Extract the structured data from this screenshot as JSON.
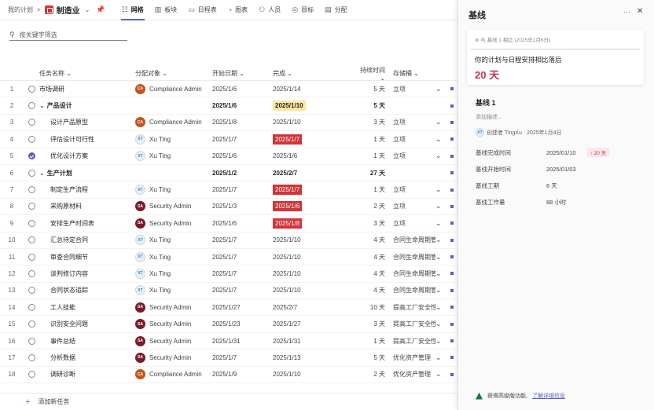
{
  "topbar": {
    "breadcrumb_root": "我的计划",
    "breadcrumb_sep": ">",
    "project_name": "制造业",
    "tabs": [
      {
        "label": "网格",
        "icon": "grid-icon"
      },
      {
        "label": "板块",
        "icon": "board-icon"
      },
      {
        "label": "日程表",
        "icon": "calendar-icon"
      },
      {
        "label": "图表",
        "icon": "chart-icon"
      },
      {
        "label": "人员",
        "icon": "people-icon"
      },
      {
        "label": "目标",
        "icon": "goal-icon"
      },
      {
        "label": "分配",
        "icon": "assign-icon"
      }
    ]
  },
  "filter": {
    "placeholder": "按关键字筛选"
  },
  "columns": {
    "name": "任务名称",
    "assignee": "分配对象",
    "start": "开始日期",
    "end": "完成",
    "duration": "持续时间",
    "bucket": "存储桶"
  },
  "rows": [
    {
      "num": "1",
      "name": "市场调研",
      "level": "top",
      "assignee": "Compliance Admin",
      "av": "ca",
      "av_text": "CA",
      "start": "2025/1/6",
      "end": "2025/1/14",
      "end_style": "",
      "duration": "5 天",
      "bucket": "立项",
      "done": false
    },
    {
      "num": "2",
      "name": "产品设计",
      "level": "group",
      "assignee": "",
      "av": "",
      "av_text": "",
      "start": "2025/1/6",
      "end": "2025/1/10",
      "end_style": "hl",
      "duration": "5 天",
      "bucket": "",
      "done": false
    },
    {
      "num": "3",
      "name": "设计产品原型",
      "level": "sub",
      "assignee": "Compliance Admin",
      "av": "ca",
      "av_text": "CA",
      "start": "2025/1/8",
      "end": "2025/1/10",
      "end_style": "",
      "duration": "3 天",
      "bucket": "立项",
      "done": false
    },
    {
      "num": "4",
      "name": "评估设计可行性",
      "level": "sub",
      "assignee": "Xu Ting",
      "av": "xt",
      "av_text": "XT",
      "start": "2025/1/7",
      "end": "2025/1/7",
      "end_style": "late",
      "duration": "1 天",
      "bucket": "立项",
      "done": false
    },
    {
      "num": "5",
      "name": "优化设计方案",
      "level": "sub",
      "assignee": "Xu Ting",
      "av": "xt",
      "av_text": "XT",
      "start": "2025/1/6",
      "end": "2025/1/6",
      "end_style": "",
      "duration": "1 天",
      "bucket": "立项",
      "done": true
    },
    {
      "num": "6",
      "name": "生产计划",
      "level": "group",
      "assignee": "",
      "av": "",
      "av_text": "",
      "start": "2025/1/2",
      "end": "2025/2/7",
      "end_style": "",
      "duration": "27 天",
      "bucket": "",
      "done": false
    },
    {
      "num": "7",
      "name": "制定生产流程",
      "level": "sub",
      "assignee": "Xu Ting",
      "av": "xt",
      "av_text": "XT",
      "start": "2025/1/7",
      "end": "2025/1/7",
      "end_style": "late",
      "duration": "1 天",
      "bucket": "立项",
      "done": false
    },
    {
      "num": "8",
      "name": "采购原材料",
      "level": "sub",
      "assignee": "Security Admin",
      "av": "sa",
      "av_text": "SA",
      "start": "2025/1/3",
      "end": "2025/1/6",
      "end_style": "late",
      "duration": "2 天",
      "bucket": "立项",
      "done": false
    },
    {
      "num": "9",
      "name": "安排生产时间表",
      "level": "sub",
      "assignee": "Security Admin",
      "av": "sa",
      "av_text": "SA",
      "start": "2025/1/6",
      "end": "2025/1/8",
      "end_style": "late",
      "duration": "3 天",
      "bucket": "立项",
      "done": false
    },
    {
      "num": "10",
      "name": "汇总待定合同",
      "level": "sub",
      "assignee": "Xu Ting",
      "av": "xt",
      "av_text": "XT",
      "start": "2025/1/7",
      "end": "2025/1/10",
      "end_style": "",
      "duration": "4 天",
      "bucket": "合同生命周期管理",
      "done": false
    },
    {
      "num": "11",
      "name": "审查合同细节",
      "level": "sub",
      "assignee": "Xu Ting",
      "av": "xt",
      "av_text": "XT",
      "start": "2025/1/7",
      "end": "2025/1/10",
      "end_style": "",
      "duration": "4 天",
      "bucket": "合同生命周期管理",
      "done": false
    },
    {
      "num": "12",
      "name": "谈判修订内容",
      "level": "sub",
      "assignee": "Xu Ting",
      "av": "xt",
      "av_text": "XT",
      "start": "2025/1/7",
      "end": "2025/1/10",
      "end_style": "",
      "duration": "4 天",
      "bucket": "合同生命周期管理",
      "done": false
    },
    {
      "num": "13",
      "name": "合同状态追踪",
      "level": "sub",
      "assignee": "Xu Ting",
      "av": "xt",
      "av_text": "XT",
      "start": "2025/1/7",
      "end": "2025/1/10",
      "end_style": "",
      "duration": "4 天",
      "bucket": "合同生命周期管理",
      "done": false
    },
    {
      "num": "14",
      "name": "工人技能",
      "level": "sub",
      "assignee": "Security Admin",
      "av": "sa",
      "av_text": "SA",
      "start": "2025/1/27",
      "end": "2025/2/7",
      "end_style": "",
      "duration": "10 天",
      "bucket": "提高工厂安全性",
      "done": false
    },
    {
      "num": "15",
      "name": "识别安全问题",
      "level": "sub",
      "assignee": "Security Admin",
      "av": "sa",
      "av_text": "SA",
      "start": "2025/1/23",
      "end": "2025/1/27",
      "end_style": "",
      "duration": "3 天",
      "bucket": "提高工厂安全性",
      "done": false
    },
    {
      "num": "16",
      "name": "事件总结",
      "level": "sub",
      "assignee": "Security Admin",
      "av": "sa",
      "av_text": "SA",
      "start": "2025/1/31",
      "end": "2025/1/31",
      "end_style": "",
      "duration": "1 天",
      "bucket": "提高工厂安全性",
      "done": false
    },
    {
      "num": "17",
      "name": "分析数据",
      "level": "sub",
      "assignee": "Security Admin",
      "av": "sa",
      "av_text": "SA",
      "start": "2025/1/7",
      "end": "2025/1/13",
      "end_style": "",
      "duration": "5 天",
      "bucket": "优化资产管理",
      "done": false
    },
    {
      "num": "18",
      "name": "调研诊断",
      "level": "sub",
      "assignee": "Compliance Admin",
      "av": "ca",
      "av_text": "CA",
      "start": "2025/1/9",
      "end": "2025/1/10",
      "end_style": "",
      "duration": "2 天",
      "bucket": "优化资产管理",
      "done": false
    }
  ],
  "add_task": "添加新任务",
  "panel": {
    "title": "基线",
    "more": "···",
    "close": "✕",
    "card_meta": "与 基线 1 相比 (2025年1月6日)",
    "card_message": "你的计划与日程安排相比落后",
    "card_days": "20 天",
    "baseline_name": "基线 1",
    "baseline_desc": "添加描述...",
    "created_by": "创建者 TingXu",
    "created_date": "2025年1月4日",
    "fields": [
      {
        "key": "基线完成时间",
        "value": "2025/01/10",
        "badge": "↑ 20 天"
      },
      {
        "key": "基线开始时间",
        "value": "2025/01/03",
        "badge": ""
      },
      {
        "key": "基线工期",
        "value": "6 天",
        "badge": ""
      },
      {
        "key": "基线工作量",
        "value": "88 小时",
        "badge": ""
      }
    ],
    "footer_text": "获得高级版功能,",
    "footer_link": "了解详细信息"
  }
}
